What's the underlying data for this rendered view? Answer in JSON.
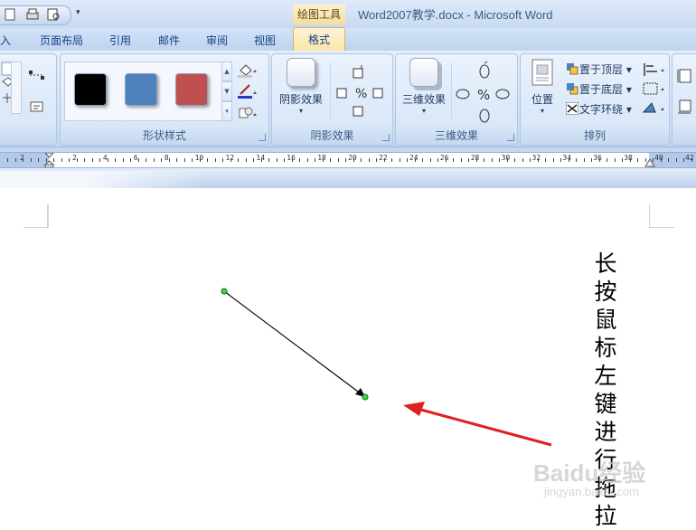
{
  "window": {
    "title": "Word2007教学.docx - Microsoft Word",
    "context_tools": "绘图工具",
    "qat_more": "▾"
  },
  "tabs": [
    {
      "label": "插入",
      "visible_text": "插入"
    },
    {
      "label": "页面布局"
    },
    {
      "label": "引用"
    },
    {
      "label": "邮件"
    },
    {
      "label": "审阅"
    },
    {
      "label": "视图"
    }
  ],
  "active_tab": "格式",
  "ribbon": {
    "shape_styles": {
      "label": "形状样式",
      "swatches": [
        "#000000",
        "#4f81bd",
        "#c0504d"
      ]
    },
    "shadow_effects": {
      "label": "阴影效果",
      "button": "阴影效果"
    },
    "three_d_effects": {
      "label": "三维效果",
      "button": "三维效果"
    },
    "arrange": {
      "label": "排列",
      "position": "位置",
      "bring_to_front": "置于顶层",
      "send_to_back": "置于底层",
      "text_wrap": "文字环绕"
    }
  },
  "ruler": {
    "numbers": [
      "2",
      "2",
      "4",
      "6",
      "8",
      "10",
      "12",
      "14",
      "16",
      "18",
      "20",
      "22",
      "24",
      "26",
      "28",
      "30",
      "32",
      "34",
      "36",
      "38",
      "40",
      "42"
    ]
  },
  "document": {
    "annotation": "长按鼠标左键进行拖拉",
    "watermark": "Baidu经验",
    "watermark_url": "jingyan.baidu.com"
  },
  "colors": {
    "accent_tab": "#fbe3a4",
    "ribbon_bg": "#d2e1f5",
    "arrow_red": "#e02020",
    "handle_green": "#33dd33"
  }
}
